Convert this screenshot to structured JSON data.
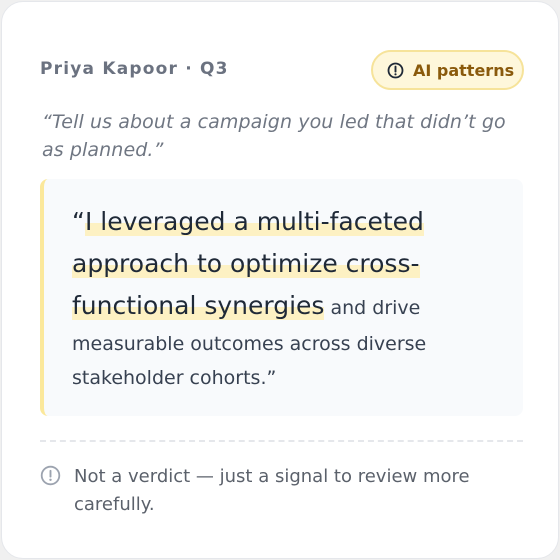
{
  "header": {
    "meta": "Priya Kapoor · Q3",
    "badge_label": "AI patterns"
  },
  "prompt": "“Tell us about a campaign you led that didn’t go as planned.”",
  "answer": {
    "open_quote": "“",
    "highlighted": "I leveraged a multi-faceted approach to optimize cross-functional synergies",
    "rest": " and drive measurable outcomes across diverse stakeholder cohorts.”"
  },
  "footer": {
    "note": "Not a verdict — just a signal to review more carefully."
  },
  "colors": {
    "badge_bg": "#fef7db",
    "badge_border": "#f6e39a",
    "badge_text": "#8a5a0c",
    "highlight": "#fdf1c3",
    "accent_bar": "#fbe89b"
  }
}
